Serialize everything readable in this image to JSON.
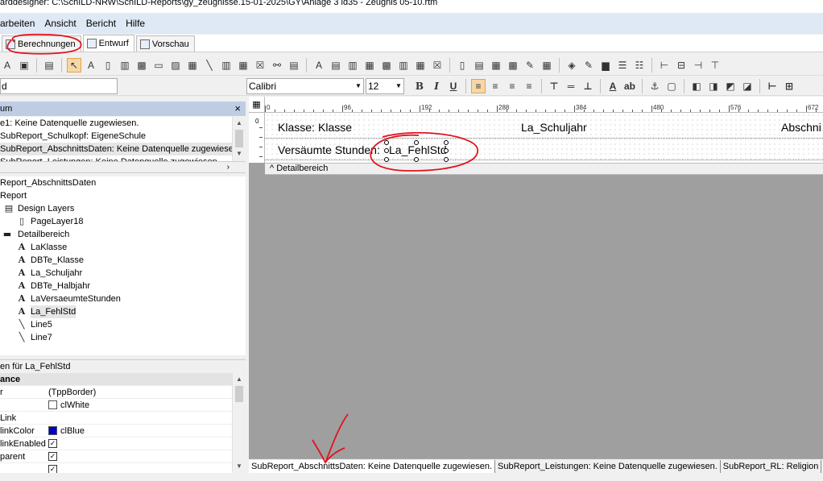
{
  "window": {
    "title": "arddesigner: C:\\SchILD-NRW\\SchILD-Reports\\gy_zeugnisse.15-01-2025\\GY\\Anlage 3 ld35 - Zeugnis 05-10.rtm"
  },
  "menu": [
    "arbeiten",
    "Ansicht",
    "Bericht",
    "Hilfe"
  ],
  "tabs": [
    {
      "label": "Berechnungen"
    },
    {
      "label": "Entwurf"
    },
    {
      "label": "Vorschau"
    }
  ],
  "toolbar": {
    "component_combo": "d",
    "font_name": "Calibri",
    "font_size": "12",
    "bold": "B",
    "italic": "I",
    "underline": "U"
  },
  "left_panel": {
    "header": "um",
    "close": "×",
    "reports": [
      "e1: Keine Datenquelle zugewiesen.",
      "SubReport_Schulkopf: EigeneSchule",
      "SubReport_AbschnittsDaten: Keine Datenquelle zugewiesen",
      "SubReport_Leistungen: Keine Datenquelle zugewiesen"
    ],
    "tree": [
      {
        "label": "Report_AbschnittsDaten",
        "icon": "none"
      },
      {
        "label": "Report",
        "icon": "none"
      },
      {
        "label": "Design Layers",
        "icon": "layers-icon"
      },
      {
        "label": "PageLayer18",
        "icon": "page-icon"
      },
      {
        "label": "Detailbereich",
        "icon": "band-icon"
      },
      {
        "label": "LaKlasse",
        "icon": "label-icon"
      },
      {
        "label": "DBTe_Klasse",
        "icon": "dbtext-icon"
      },
      {
        "label": "La_Schuljahr",
        "icon": "label-icon"
      },
      {
        "label": "DBTe_Halbjahr",
        "icon": "dbtext-icon"
      },
      {
        "label": "LaVersaeumteStunden",
        "icon": "label-icon"
      },
      {
        "label": "La_FehlStd",
        "icon": "label-icon"
      },
      {
        "label": "Line5",
        "icon": "line-icon"
      },
      {
        "label": "Line7",
        "icon": "line-icon"
      }
    ]
  },
  "properties": {
    "header": "en für La_FehlStd",
    "rows": [
      {
        "name": "ance",
        "value": "",
        "type": "category"
      },
      {
        "name": "r",
        "value": "(TppBorder)",
        "type": "text"
      },
      {
        "name": "",
        "value": "clWhite",
        "type": "color",
        "color": "#ffffff"
      },
      {
        "name": "Link",
        "value": "",
        "type": "text"
      },
      {
        "name": "linkColor",
        "value": "clBlue",
        "type": "color",
        "color": "#0000cc"
      },
      {
        "name": "linkEnabled",
        "value": "✓",
        "type": "check"
      },
      {
        "name": "parent",
        "value": "✓",
        "type": "check"
      },
      {
        "name": "",
        "value": "✓",
        "type": "check"
      }
    ]
  },
  "designer": {
    "ruler_corner": "▦",
    "ruler_ticks": [
      "0",
      "96",
      "192",
      "288",
      "384",
      "480",
      "576",
      "672"
    ],
    "ruler_v_label": "0",
    "fields": {
      "klasse_label": "Klasse:",
      "klasse_value": "Klasse",
      "schuljahr": "La_Schuljahr",
      "abschnitt": "Abschni",
      "versaeumt_label": "Versäumte Stunden:",
      "fehlstd": "La_FehlStd"
    },
    "detail_band": "^ Detailbereich"
  },
  "bottom_tabs": [
    "SubReport_AbschnittsDaten: Keine Datenquelle zugewiesen.",
    "SubReport_Leistungen: Keine Datenquelle zugewiesen.",
    "SubReport_RL: Religion",
    "S"
  ],
  "colors": {
    "menu_bg": "#dfe8f5",
    "panel_header": "#bfcde4",
    "designer_bg": "#9f9f9f",
    "annotation": "#e0141e"
  }
}
